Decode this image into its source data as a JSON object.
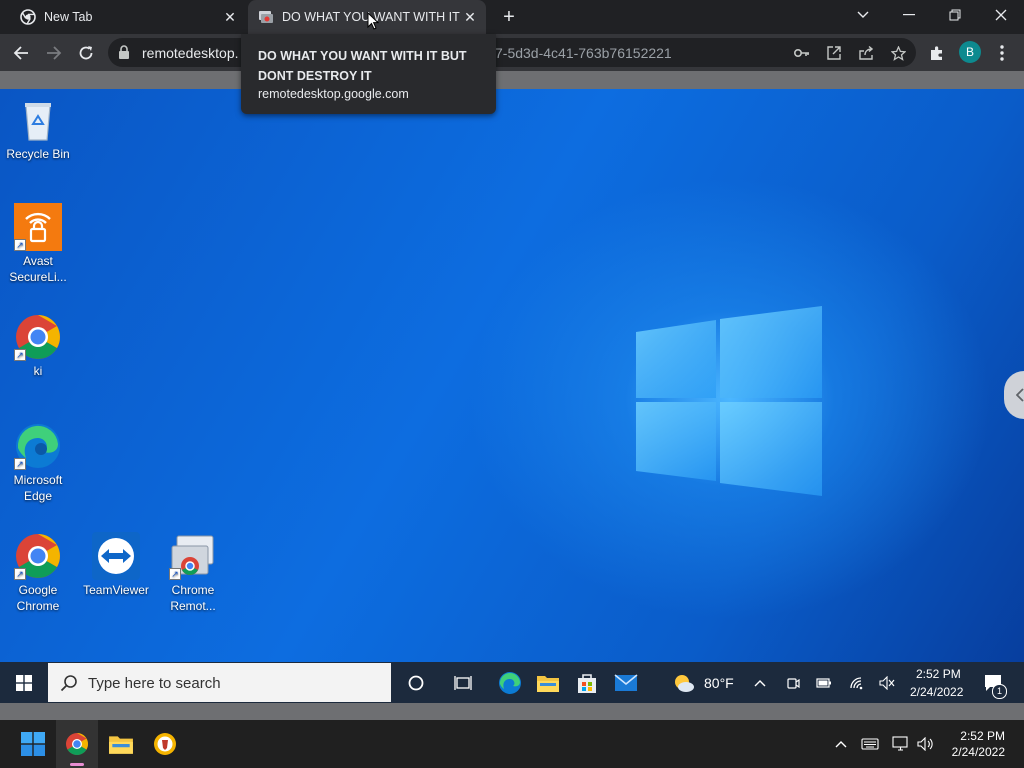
{
  "browser": {
    "tabs": [
      {
        "label": "New Tab",
        "active": false
      },
      {
        "label": "DO WHAT YOU WANT WITH IT BUT DONT DESTROY IT",
        "active": true
      }
    ],
    "omnibox": {
      "host": "remotedesktop.",
      "rest": "7-5d3d-4c41-763b76152221"
    },
    "profile_initial": "B",
    "tooltip": {
      "title": "DO WHAT YOU WANT WITH IT BUT DONT DESTROY IT",
      "url": "remotedesktop.google.com"
    }
  },
  "remote_desktop": {
    "icons": [
      {
        "label": "Recycle Bin",
        "icon": "recycle-bin-icon"
      },
      {
        "label": "Avast SecureLi...",
        "icon": "avast-secureline-icon"
      },
      {
        "label": "ki",
        "icon": "chrome-icon"
      },
      {
        "label": "Microsoft Edge",
        "icon": "edge-icon"
      },
      {
        "label": "Google Chrome",
        "icon": "chrome-icon"
      },
      {
        "label": "TeamViewer",
        "icon": "teamviewer-icon"
      },
      {
        "label": "Chrome Remot...",
        "icon": "chrome-remote-desktop-icon"
      }
    ],
    "taskbar": {
      "search_placeholder": "Type here to search",
      "weather": "80°F",
      "time": "2:52 PM",
      "date": "2/24/2022",
      "notifications": "1"
    }
  },
  "host_taskbar": {
    "time": "2:52 PM",
    "date": "2/24/2022"
  },
  "colors": {
    "chrome_dark": "#202124",
    "chrome_toolbar": "#35363a",
    "desktop_blue": "#0d6de0",
    "profile": "#0d8a8f"
  }
}
